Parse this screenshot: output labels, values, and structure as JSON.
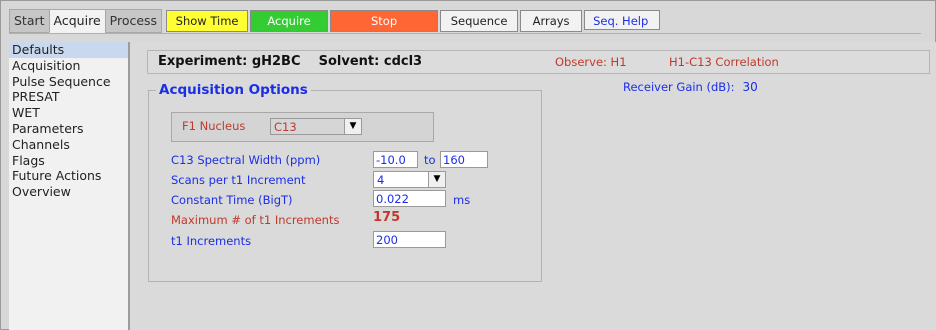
{
  "tabs": [
    {
      "label": "Start",
      "state": "inactive"
    },
    {
      "label": "Acquire",
      "state": "active"
    },
    {
      "label": "Process",
      "state": "inactive"
    }
  ],
  "toolbar": {
    "show_time": "Show Time",
    "acquire": "Acquire",
    "stop": "Stop",
    "sequence": "Sequence",
    "arrays": "Arrays",
    "seq_help": "Seq. Help"
  },
  "colors": {
    "show_time_bg": "#ffff33",
    "acquire_bg": "#33cc33",
    "stop_bg": "#ff6633",
    "label_blue": "#1a2ee6",
    "label_red": "#c0392b"
  },
  "sidebar": {
    "items": [
      {
        "label": "Defaults",
        "selected": true
      },
      {
        "label": "Acquisition",
        "selected": false
      },
      {
        "label": "Pulse Sequence",
        "selected": false
      },
      {
        "label": "PRESAT",
        "selected": false
      },
      {
        "label": "WET",
        "selected": false
      },
      {
        "label": "Parameters",
        "selected": false
      },
      {
        "label": "Channels",
        "selected": false
      },
      {
        "label": "Flags",
        "selected": false
      },
      {
        "label": "Future Actions",
        "selected": false
      },
      {
        "label": "Overview",
        "selected": false
      }
    ]
  },
  "info": {
    "experiment_label": "Experiment:",
    "experiment_value": "gH2BC",
    "solvent_label": "Solvent:",
    "solvent_value": "cdcl3",
    "observe": "Observe: H1",
    "correlation": "H1-C13 Correlation"
  },
  "acq": {
    "group_title": "Acquisition Options",
    "f1_nucleus_label": "F1 Nucleus",
    "f1_nucleus_value": "C13",
    "spectral_width_label": "C13 Spectral Width (ppm)",
    "spectral_width_from": "-10.0",
    "to_label": "to",
    "spectral_width_to": "160",
    "scans_label": "Scans per t1 Increment",
    "scans_value": "4",
    "constant_time_label": "Constant Time (BigT)",
    "constant_time_value": "0.022",
    "constant_time_unit": "ms",
    "max_increments_label": "Maximum # of  t1 Increments",
    "max_increments_value": "175",
    "t1_increments_label": "t1 Increments",
    "t1_increments_value": "200"
  },
  "receiver": {
    "label": "Receiver Gain (dB):",
    "value": "30"
  },
  "icons": {
    "dropdown": "chevron-down-icon"
  }
}
